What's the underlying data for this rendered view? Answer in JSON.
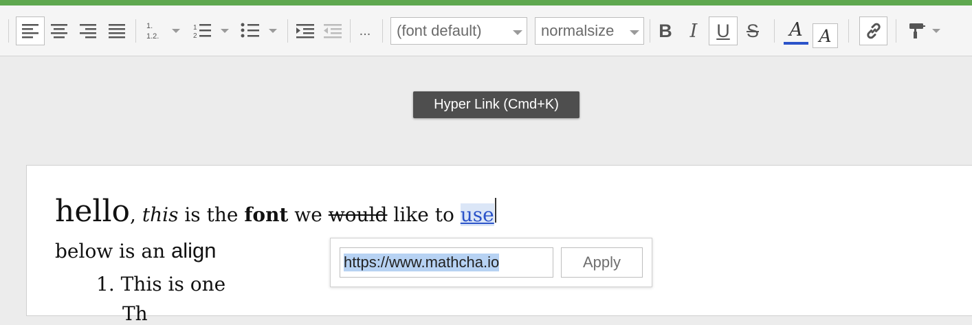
{
  "colors": {
    "accent_bar": "#5fa84f",
    "link": "#2b53c9",
    "selection": "#b7d2f3"
  },
  "toolbar": {
    "more_label": "...",
    "font_family": {
      "value": "(font default)"
    },
    "font_size": {
      "value": "normalsize"
    },
    "bold_label": "B",
    "italic_label": "I",
    "underline_label": "U",
    "strike_label": "S",
    "text_color_label": "A",
    "highlight_label": "A",
    "icons": [
      "align-left-icon",
      "align-center-icon",
      "align-right-icon",
      "align-justify-icon",
      "numbering-style-icon",
      "ordered-list-icon",
      "bullet-list-icon",
      "indent-icon",
      "outdent-icon",
      "link-icon",
      "format-painter-icon"
    ]
  },
  "tooltip": {
    "text": "Hyper Link (Cmd+K)"
  },
  "document": {
    "line1": {
      "hello": "hello",
      "comma": ",",
      "this": "this",
      "is_the": "is the",
      "font": "font",
      "we": "we",
      "would": "would",
      "like_to": "like to",
      "use": "use"
    },
    "line2": {
      "text": "below is an",
      "align": "align"
    },
    "list": [
      {
        "number": "1.",
        "text": "This is one"
      },
      {
        "text": "Th"
      }
    ]
  },
  "link_popup": {
    "url_value": "https://www.mathcha.io",
    "apply_label": "Apply"
  }
}
